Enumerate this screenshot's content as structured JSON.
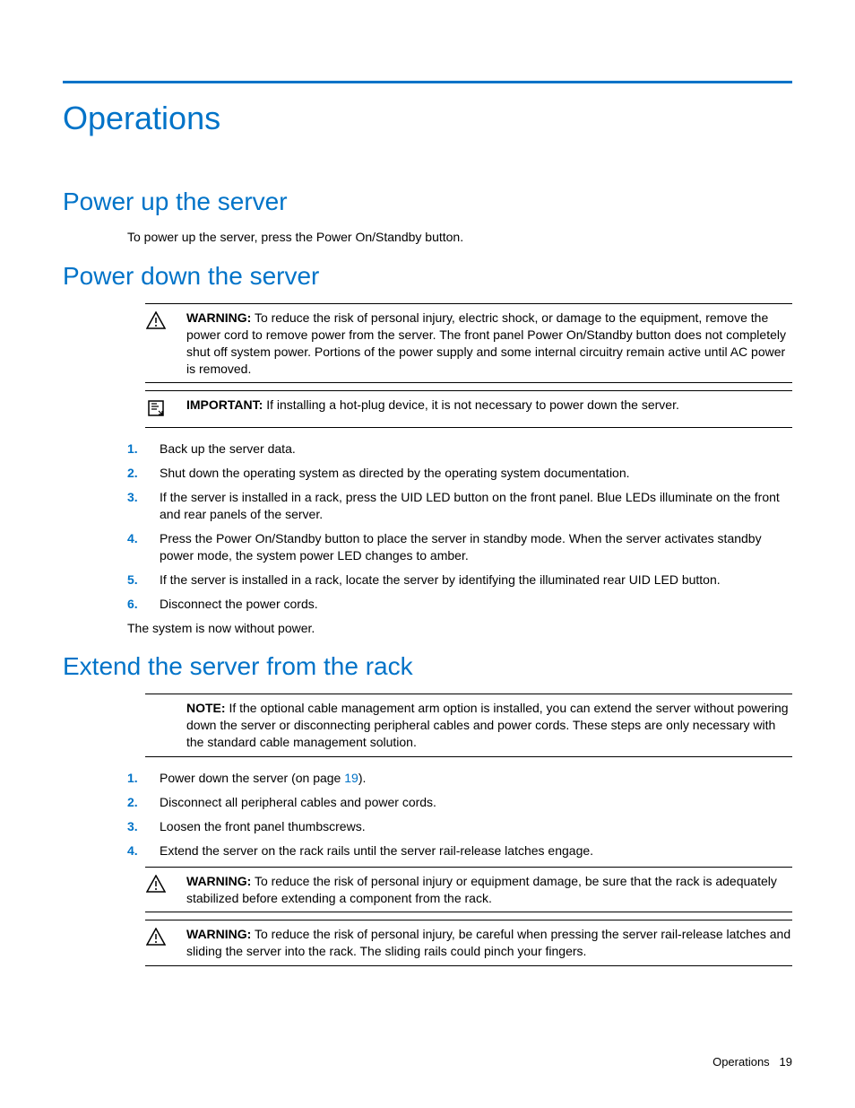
{
  "title": "Operations",
  "section1": {
    "heading": "Power up the server",
    "text": "To power up the server, press the Power On/Standby button."
  },
  "section2": {
    "heading": "Power down the server",
    "warning_label": "WARNING:",
    "warning_text": "To reduce the risk of personal injury, electric shock, or damage to the equipment, remove the power cord to remove power from the server. The front panel Power On/Standby button does not completely shut off system power. Portions of the power supply and some internal circuitry remain active until AC power is removed.",
    "important_label": "IMPORTANT:",
    "important_text": "If installing a hot-plug device, it is not necessary to power down the server.",
    "steps": [
      "Back up the server data.",
      "Shut down the operating system as directed by the operating system documentation.",
      "If the server is installed in a rack, press the UID LED button on the front panel. Blue LEDs illuminate on the front and rear panels of the server.",
      "Press the Power On/Standby button to place the server in standby mode. When the server activates standby power mode, the system power LED changes to amber.",
      "If the server is installed in a rack, locate the server by identifying the illuminated rear UID LED button.",
      "Disconnect the power cords."
    ],
    "after": "The system is now without power."
  },
  "section3": {
    "heading": "Extend the server from the rack",
    "note_label": "NOTE:",
    "note_text": "If the optional cable management arm option is installed, you can extend the server without powering down the server or disconnecting peripheral cables and power cords. These steps are only necessary with the standard cable management solution.",
    "steps": [
      {
        "pre": "Power down the server (on page ",
        "link": "19",
        "post": ")."
      },
      "Disconnect all peripheral cables and power cords.",
      "Loosen the front panel thumbscrews.",
      "Extend the server on the rack rails until the server rail-release latches engage."
    ],
    "warning2_label": "WARNING:",
    "warning2_text": "To reduce the risk of personal injury or equipment damage, be sure that the rack is adequately stabilized before extending a component from the rack.",
    "warning3_label": "WARNING:",
    "warning3_text": "To reduce the risk of personal injury, be careful when pressing the server rail-release latches and sliding the server into the rack. The sliding rails could pinch your fingers."
  },
  "footer": {
    "section": "Operations",
    "page": "19"
  }
}
